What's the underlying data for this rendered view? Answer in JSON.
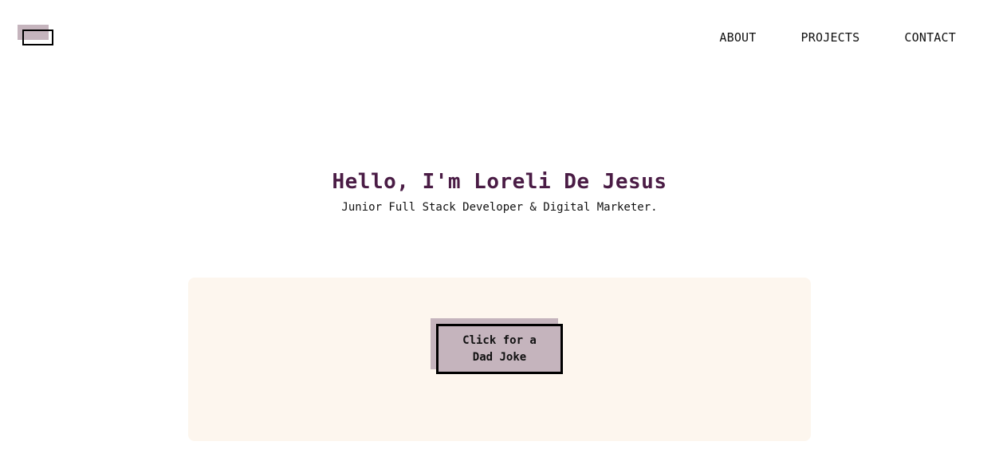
{
  "colors": {
    "accent": "#4a1c45",
    "accent_soft": "#c5b4bd",
    "card_background": "#fdf6ee",
    "text": "#111111"
  },
  "header": {
    "logo_icon": "logo-icon",
    "nav": [
      {
        "label": "ABOUT"
      },
      {
        "label": "PROJECTS"
      },
      {
        "label": "CONTACT"
      }
    ]
  },
  "hero": {
    "title": "Hello, I'm Loreli De Jesus",
    "subtitle": "Junior Full Stack Developer & Digital Marketer."
  },
  "joke": {
    "button_label": "Click for a Dad Joke"
  }
}
